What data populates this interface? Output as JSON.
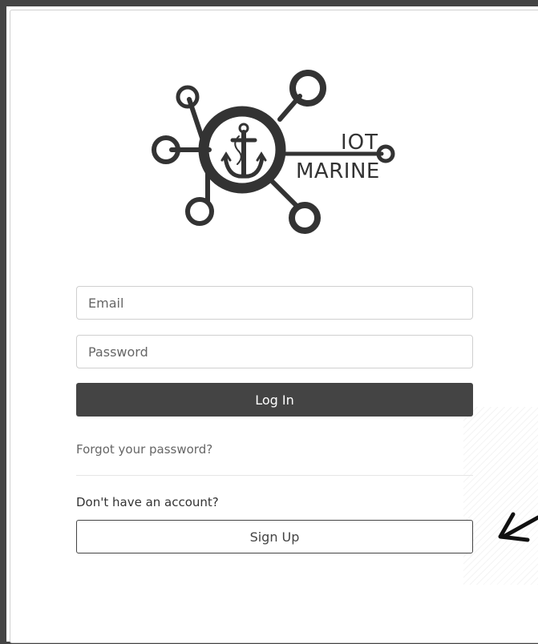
{
  "brand": {
    "logo_line1": "IOT",
    "logo_line2": "MARINE",
    "logo_icon": "anchor-network-icon"
  },
  "form": {
    "email_placeholder": "Email",
    "password_placeholder": "Password",
    "login_label": "Log In",
    "forgot_label": "Forgot your password?",
    "no_account_label": "Don't have an account?",
    "signup_label": "Sign Up"
  },
  "colors": {
    "accent": "#444444",
    "border": "#cfcfcf",
    "muted_text": "#666666"
  },
  "annotation": {
    "icon": "arrow-pointing-left-icon"
  }
}
